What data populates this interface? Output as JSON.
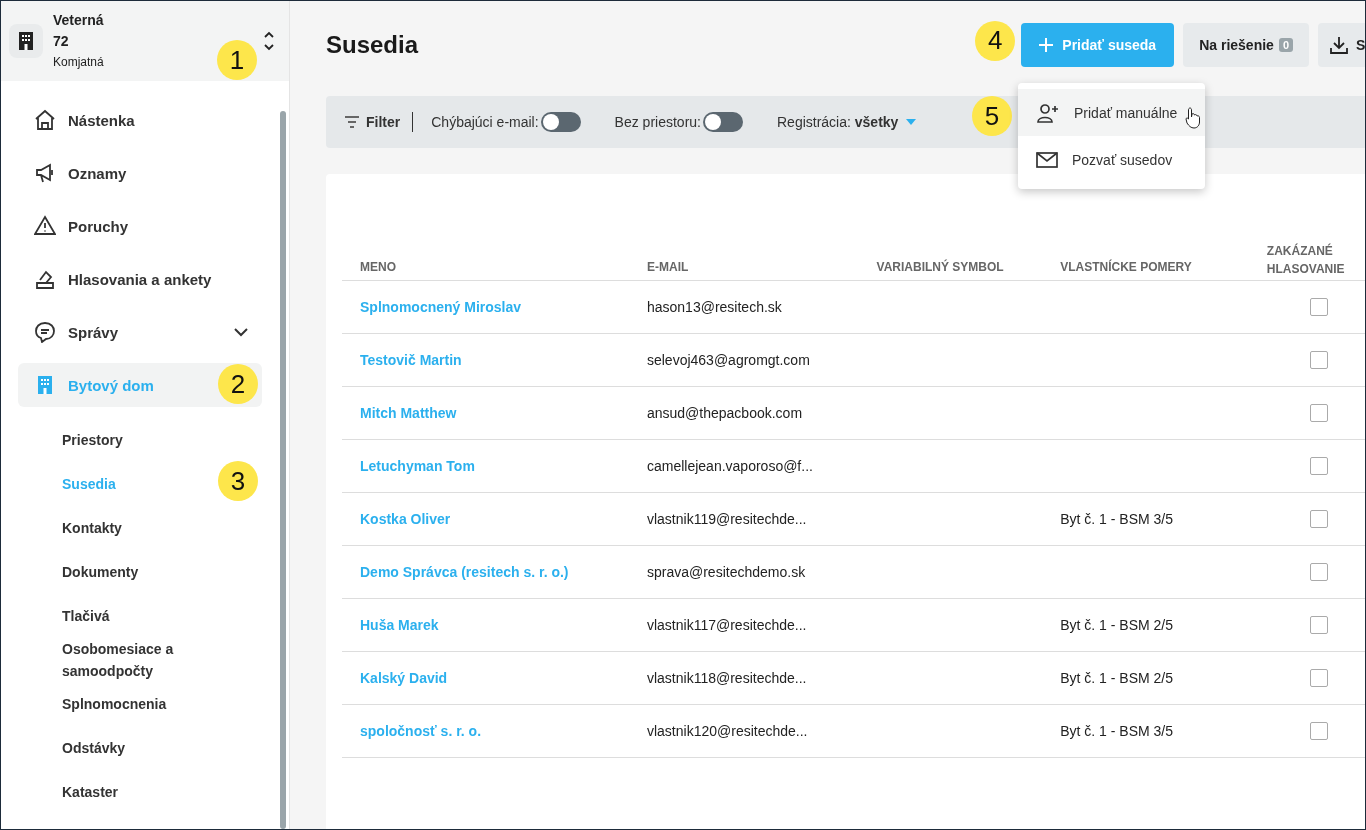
{
  "building": {
    "street": "Veterná",
    "number": "72",
    "city": "Komjatná"
  },
  "nav": [
    {
      "label": "Nástenka",
      "selected": false,
      "expandable": false
    },
    {
      "label": "Oznamy",
      "selected": false,
      "expandable": false
    },
    {
      "label": "Poruchy",
      "selected": false,
      "expandable": false
    },
    {
      "label": "Hlasovania a ankety",
      "selected": false,
      "expandable": false
    },
    {
      "label": "Správy",
      "selected": false,
      "expandable": true
    },
    {
      "label": "Bytový dom",
      "selected": true,
      "expandable": false
    }
  ],
  "subnav": [
    {
      "label": "Priestory",
      "selected": false
    },
    {
      "label": "Susedia",
      "selected": true
    },
    {
      "label": "Kontakty",
      "selected": false
    },
    {
      "label": "Dokumenty",
      "selected": false
    },
    {
      "label": "Tlačivá",
      "selected": false
    },
    {
      "label": "Osobomesiace a samoodpočty",
      "selected": false
    },
    {
      "label": "Splnomocnenia",
      "selected": false
    },
    {
      "label": "Odstávky",
      "selected": false
    },
    {
      "label": "Kataster",
      "selected": false
    }
  ],
  "page_title": "Susedia",
  "actions": {
    "add": "Pridať suseda",
    "pending": "Na riešenie",
    "pending_count": "0",
    "export": "S"
  },
  "filters": {
    "label": "Filter",
    "toggles": [
      {
        "label": "Chýbajúci e-mail:",
        "on": false
      },
      {
        "label": "Bez priestoru:",
        "on": false
      }
    ],
    "registration": "Registrácia: **všetky**"
  },
  "menu": [
    {
      "label": "Pridať manuálne",
      "selected": true
    },
    {
      "label": "Pozvať susedov",
      "selected": false
    }
  ],
  "table": {
    "columns": [
      "MENO",
      "E-MAIL",
      "VARIABILNÝ SYMBOL",
      "VLASTNÍCKE POMERY",
      "ZAKÁZANÉ HLASOVANIE"
    ],
    "rows": [
      {
        "name": "Splnomocnený Miroslav",
        "email": "hason13@resitech.sk",
        "blocked": false
      },
      {
        "name": "Testovič Martin",
        "email": "selevoj463@agromgt.com",
        "blocked": false
      },
      {
        "name": "Mitch Matthew",
        "email": "ansud@thepacbook.com",
        "blocked": false
      },
      {
        "name": "Letuchyman Tom",
        "email": "camellejean.vaporoso@f...",
        "blocked": false
      },
      {
        "name": "Kostka Oliver",
        "email": "vlastnik119@resitechde...",
        "ownership": "Byt č. 1 - BSM 3/5",
        "blocked": false
      },
      {
        "name": "Demo Správca (resitech s. r. o.)",
        "email": "sprava@resitechdemo.sk",
        "blocked": false
      },
      {
        "name": "Huša Marek",
        "email": "vlastnik117@resitechde...",
        "ownership": "Byt č. 1 - BSM 2/5",
        "blocked": false
      },
      {
        "name": "Kalský David",
        "email": "vlastnik118@resitechde...",
        "ownership": "Byt č. 1 - BSM 2/5",
        "blocked": false
      },
      {
        "name": "spoločnosť s. r. o.",
        "email": "vlastnik120@resitechde...",
        "ownership": "Byt č. 1 - BSM 3/5",
        "blocked": false
      }
    ]
  },
  "callouts": [
    "1",
    "2",
    "3",
    "4",
    "5"
  ]
}
